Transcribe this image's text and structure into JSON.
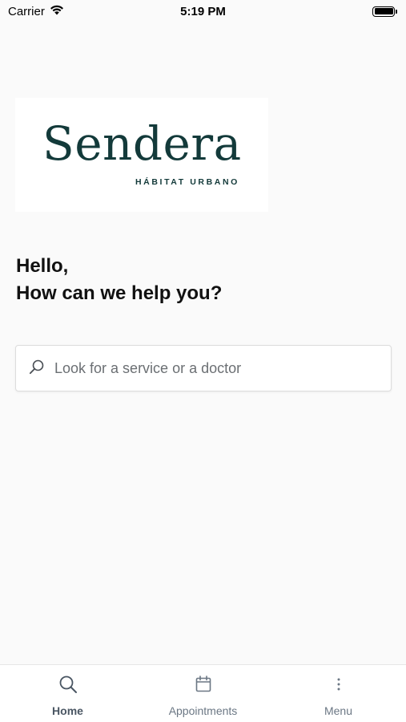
{
  "status_bar": {
    "carrier": "Carrier",
    "time": "5:19 PM"
  },
  "logo": {
    "wordmark": "Sendera",
    "tagline": "HÁBITAT URBANO",
    "color": "#133a3a"
  },
  "greeting": {
    "line1": "Hello,",
    "line2": "How can we help you?"
  },
  "search": {
    "placeholder": "Look for a service or a doctor",
    "value": "",
    "icon": "search-icon"
  },
  "tab_bar": {
    "tabs": [
      {
        "label": "Home",
        "icon": "search-icon",
        "active": true
      },
      {
        "label": "Appointments",
        "icon": "calendar-icon",
        "active": false
      },
      {
        "label": "Menu",
        "icon": "more-vertical-icon",
        "active": false
      }
    ]
  }
}
